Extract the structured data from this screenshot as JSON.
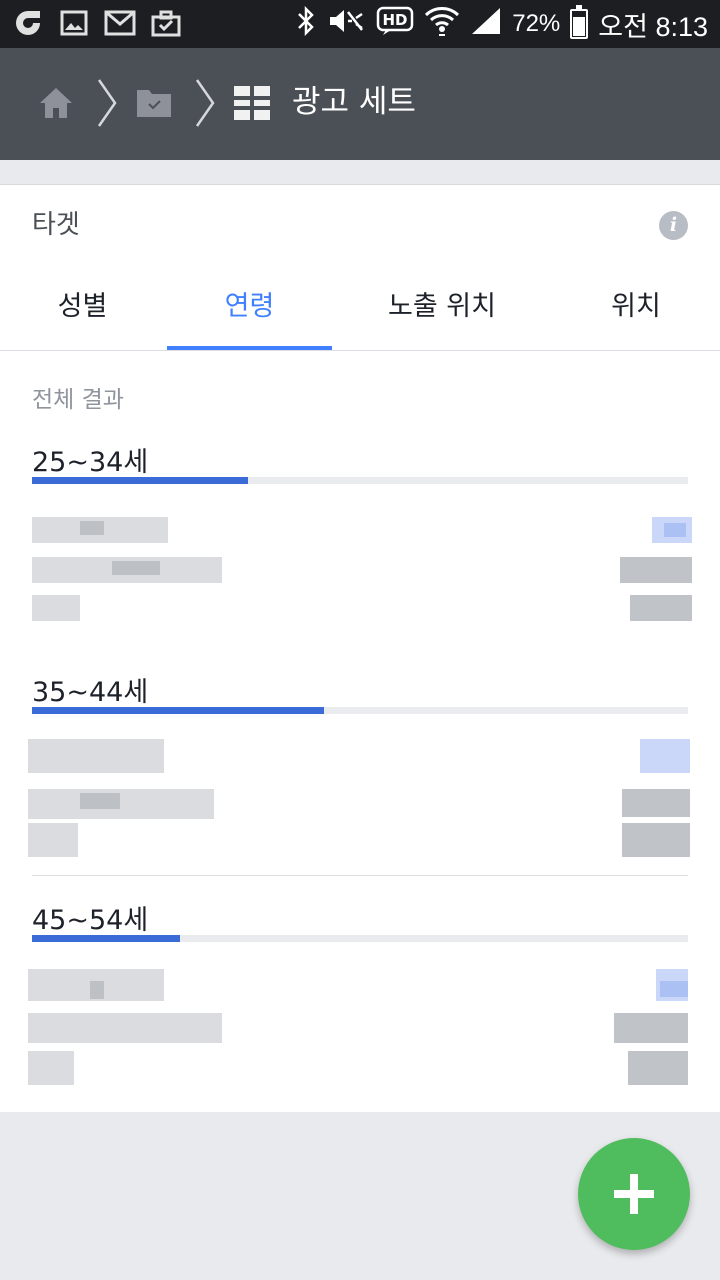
{
  "status_bar": {
    "battery_percent": "72%",
    "time": "오전 8:13",
    "icons": [
      "app-icon",
      "image-icon",
      "gmail-icon",
      "briefcase-icon",
      "bluetooth-icon",
      "mute-icon",
      "hd-icon",
      "wifi-icon",
      "signal-icon",
      "battery-icon"
    ]
  },
  "nav": {
    "title": "광고 세트",
    "icons": [
      "home-icon",
      "chevron-right-icon",
      "folder-icon",
      "chevron-right-icon",
      "grid-icon"
    ]
  },
  "card": {
    "title": "타겟",
    "tabs": [
      "성별",
      "연령",
      "노출 위치",
      "위치"
    ],
    "active_tab": "연령",
    "section_label": "전체 결과"
  },
  "age_groups": [
    {
      "label": "25~34세",
      "share": 0.33
    },
    {
      "label": "35~44세",
      "share": 0.445
    },
    {
      "label": "45~54세",
      "share": 0.225
    }
  ],
  "colors": {
    "accent": "#4080ff",
    "bar": "#3a6bd6",
    "fab": "#4fbd5d",
    "nav": "#4b4f56"
  }
}
